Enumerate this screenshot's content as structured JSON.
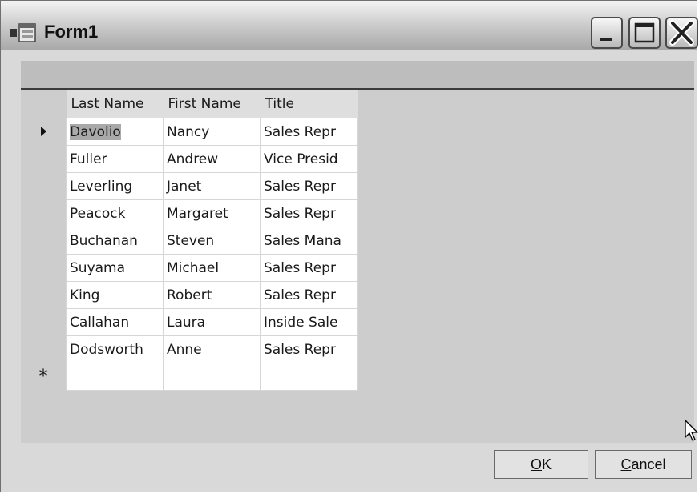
{
  "window": {
    "title": "Form1"
  },
  "grid": {
    "headers": [
      "Last Name",
      "First Name",
      "Title"
    ],
    "rows": [
      [
        "Davolio",
        "Nancy",
        "Sales Repr"
      ],
      [
        "Fuller",
        "Andrew",
        "Vice Presid"
      ],
      [
        "Leverling",
        "Janet",
        "Sales Repr"
      ],
      [
        "Peacock",
        "Margaret",
        "Sales Repr"
      ],
      [
        "Buchanan",
        "Steven",
        "Sales Mana"
      ],
      [
        "Suyama",
        "Michael",
        "Sales Repr"
      ],
      [
        "King",
        "Robert",
        "Sales Repr"
      ],
      [
        "Callahan",
        "Laura",
        "Inside Sale"
      ],
      [
        "Dodsworth",
        "Anne",
        "Sales Repr"
      ]
    ],
    "new_row_marker": "*"
  },
  "buttons": {
    "ok_access": "O",
    "ok_rest": "K",
    "cancel_access": "C",
    "cancel_rest": "ancel"
  },
  "icons": {
    "app": "form-app-icon",
    "minimize": "minimize-icon",
    "maximize": "maximize-icon",
    "close": "close-icon",
    "current_row": "current-row-arrow-icon",
    "cursor": "mouse-pointer-icon"
  }
}
